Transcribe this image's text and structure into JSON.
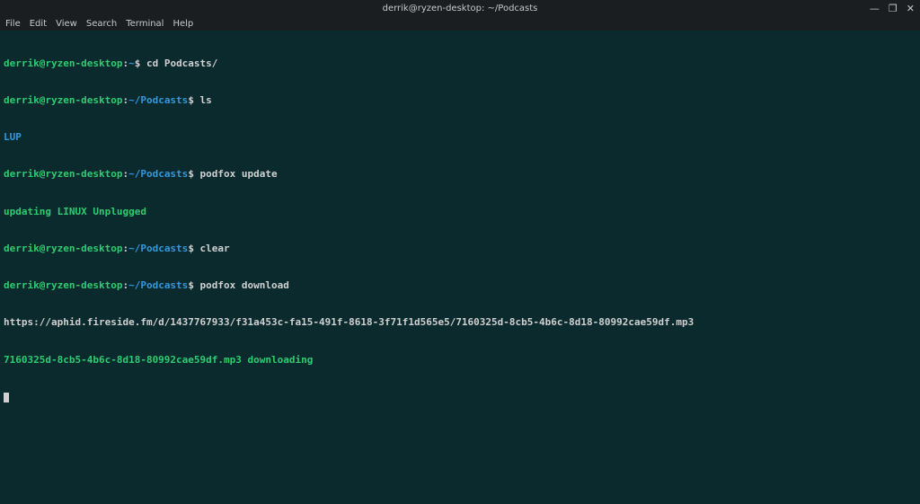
{
  "window": {
    "title": "derrik@ryzen-desktop: ~/Podcasts",
    "controls": {
      "minimize": "—",
      "maximize": "❐",
      "close": "✕"
    }
  },
  "menubar": {
    "items": [
      "File",
      "Edit",
      "View",
      "Search",
      "Terminal",
      "Help"
    ]
  },
  "prompt": {
    "user_host": "derrik@ryzen-desktop",
    "sep": ":",
    "home_path": "~",
    "podcasts_path": "~/Podcasts",
    "symbol": "$"
  },
  "lines": {
    "cmd0": " cd Podcasts/",
    "cmd1": " ls",
    "out_lup": "LUP",
    "cmd2": " podfox update",
    "out_update": "updating LINUX Unplugged",
    "cmd3": " clear",
    "cmd4": " podfox download",
    "out_url": "https://aphid.fireside.fm/d/1437767933/f31a453c-fa15-491f-8618-3f71f1d565e5/7160325d-8cb5-4b6c-8d18-80992cae59df.mp3",
    "out_downloading": "7160325d-8cb5-4b6c-8d18-80992cae59df.mp3 downloading"
  }
}
